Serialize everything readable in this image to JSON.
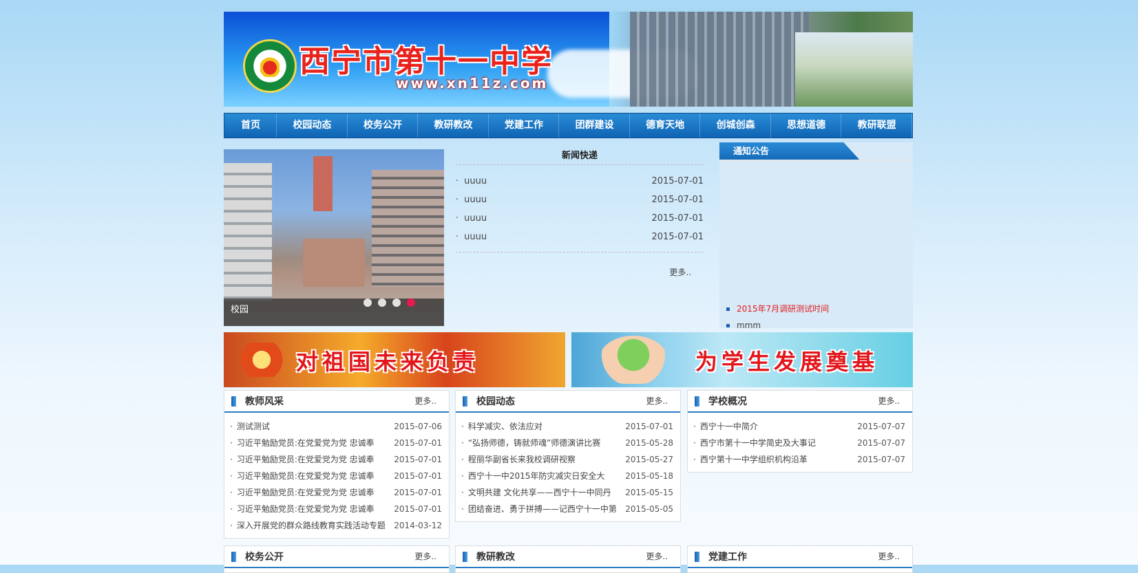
{
  "header": {
    "school_name": "西宁市第十一中学",
    "site_url": "www.xn11z.com"
  },
  "nav": [
    "首页",
    "校园动态",
    "校务公开",
    "教研教改",
    "党建工作",
    "团群建设",
    "德育天地",
    "创城创森",
    "思想道德",
    "教研联盟"
  ],
  "slider": {
    "caption": "校园",
    "dots": 4,
    "active_dot": 4
  },
  "news": {
    "title": "新闻快递",
    "items": [
      {
        "title": "uuuu",
        "date": "2015-07-01"
      },
      {
        "title": "uuuu",
        "date": "2015-07-01"
      },
      {
        "title": "uuuu",
        "date": "2015-07-01"
      },
      {
        "title": "uuuu",
        "date": "2015-07-01"
      }
    ],
    "more": "更多.."
  },
  "notice": {
    "title": "通知公告",
    "items": [
      {
        "title": "2015年7月调研测试时间",
        "highlight": true
      },
      {
        "title": "mmm",
        "highlight": false
      }
    ]
  },
  "promos": {
    "left": "对祖国未来负责",
    "right": "为学生发展奠基"
  },
  "boxes": [
    {
      "title": "教师风采",
      "more": "更多..",
      "items": [
        {
          "title": "测试测试",
          "date": "2015-07-06"
        },
        {
          "title": "习近平勉励党员:在党爱党为党 忠诚奉",
          "date": "2015-07-01"
        },
        {
          "title": "习近平勉励党员:在党爱党为党 忠诚奉",
          "date": "2015-07-01"
        },
        {
          "title": "习近平勉励党员:在党爱党为党 忠诚奉",
          "date": "2015-07-01"
        },
        {
          "title": "习近平勉励党员:在党爱党为党 忠诚奉",
          "date": "2015-07-01"
        },
        {
          "title": "习近平勉励党员:在党爱党为党 忠诚奉",
          "date": "2015-07-01"
        },
        {
          "title": "深入开展党的群众路线教育实践活动专题",
          "date": "2014-03-12"
        }
      ]
    },
    {
      "title": "校园动态",
      "more": "更多..",
      "items": [
        {
          "title": "科学减灾、依法应对",
          "date": "2015-07-01"
        },
        {
          "title": "“弘扬师德，铸就师魂”师德演讲比赛",
          "date": "2015-05-28"
        },
        {
          "title": "程丽华副省长来我校调研视察",
          "date": "2015-05-27"
        },
        {
          "title": "西宁十一中2015年防灾减灾日安全大",
          "date": "2015-05-18"
        },
        {
          "title": "文明共建 文化共享——西宁十一中同丹",
          "date": "2015-05-15"
        },
        {
          "title": "团结奋进、勇于拼搏——记西宁十一中第",
          "date": "2015-05-05"
        }
      ]
    },
    {
      "title": "学校概况",
      "more": "更多..",
      "items": [
        {
          "title": "西宁十一中简介",
          "date": "2015-07-07"
        },
        {
          "title": "西宁市第十一中学简史及大事记",
          "date": "2015-07-07"
        },
        {
          "title": "西宁第十一中学组织机构沿革",
          "date": "2015-07-07"
        }
      ]
    }
  ],
  "bottom_boxes": [
    {
      "title": "校务公开",
      "more": "更多.."
    },
    {
      "title": "教研教改",
      "more": "更多.."
    },
    {
      "title": "党建工作",
      "more": "更多.."
    }
  ]
}
